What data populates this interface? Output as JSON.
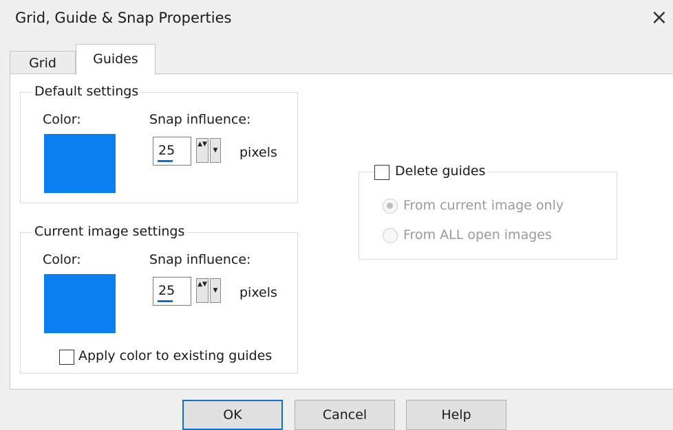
{
  "window": {
    "title": "Grid, Guide & Snap Properties",
    "close_glyph": "×"
  },
  "tabs": [
    {
      "label": "Grid",
      "selected": false
    },
    {
      "label": "Guides",
      "selected": true
    }
  ],
  "default_settings": {
    "legend": "Default settings",
    "color_label": "Color:",
    "color": "#0a7ff0",
    "snap_label": "Snap influence:",
    "snap_value": "25",
    "snap_unit": "pixels"
  },
  "current_settings": {
    "legend": "Current image settings",
    "color_label": "Color:",
    "color": "#0a7ff0",
    "snap_label": "Snap influence:",
    "snap_value": "25",
    "snap_unit": "pixels",
    "apply_label": "Apply color to existing guides",
    "apply_checked": false
  },
  "delete_guides": {
    "label": "Delete guides",
    "checked": false,
    "options": [
      {
        "label": "From current image only",
        "selected": true
      },
      {
        "label": "From ALL open images",
        "selected": false
      }
    ]
  },
  "buttons": {
    "ok": "OK",
    "cancel": "Cancel",
    "help": "Help"
  },
  "icons": {
    "spin_up_down": "▲▼",
    "dropdown": "▼"
  }
}
